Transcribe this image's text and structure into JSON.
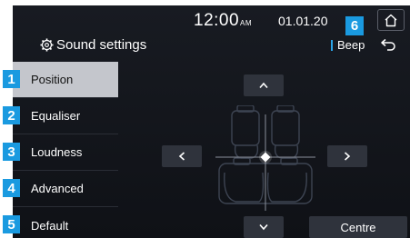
{
  "status": {
    "time": "12:00",
    "ampm": "AM",
    "date": "01.01.20"
  },
  "header": {
    "title": "Sound settings",
    "beep_label": "Beep"
  },
  "sidebar": {
    "items": [
      {
        "label": "Position",
        "badge": "1",
        "active": true
      },
      {
        "label": "Equaliser",
        "badge": "2",
        "active": false
      },
      {
        "label": "Loudness",
        "badge": "3",
        "active": false
      },
      {
        "label": "Advanced",
        "badge": "4",
        "active": false
      },
      {
        "label": "Default",
        "badge": "5",
        "active": false
      }
    ]
  },
  "main": {
    "centre_label": "Centre"
  },
  "callout_badge": "6",
  "colors": {
    "accent": "#1a9ae0",
    "active_item": "#c4c6cc",
    "background": "#14171d"
  },
  "icons": [
    "home-icon",
    "gear-icon",
    "back-icon",
    "chevron-up-icon",
    "chevron-down-icon",
    "chevron-left-icon",
    "chevron-right-icon"
  ]
}
